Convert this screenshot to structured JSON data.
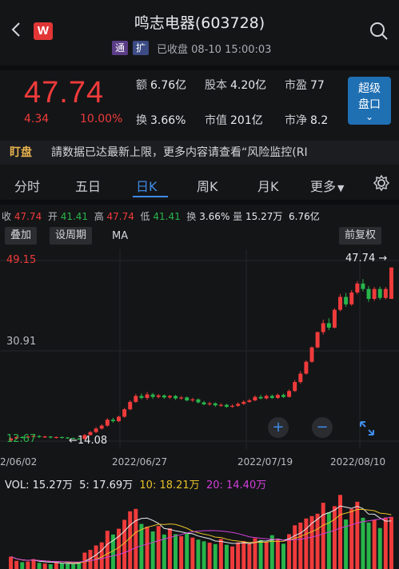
{
  "header": {
    "title": "鸣志电器(603728)",
    "logo_letter": "W",
    "tag_tong": "通",
    "tag_kuo": "扩",
    "status": "已收盘 08-10 15:00:03"
  },
  "quote": {
    "price": "47.74",
    "change": "4.34",
    "change_pct": "10.00%",
    "e_label": "额",
    "e_value": "6.76亿",
    "gb_label": "股本",
    "gb_value": "4.20亿",
    "sy_label": "市盈",
    "sy_value": "77",
    "h_label": "换",
    "h_value": "3.66%",
    "sz_label": "市值",
    "sz_value": "201亿",
    "sj_label": "市净",
    "sj_value": "8.2",
    "super_btn_line1": "超级",
    "super_btn_line2": "盘口",
    "super_btn_arrow": "⌄"
  },
  "ticker": {
    "tag": "盯盘",
    "text": "請数据已达最新上限，更多内容请查看“风险监控(RI"
  },
  "tabs": [
    "分时",
    "五日",
    "日K",
    "周K",
    "月K",
    "更多"
  ],
  "active_tab": "日K",
  "ohlc": {
    "close_label": "收",
    "close": "47.74",
    "open_label": "开",
    "open": "41.41",
    "high_label": "高",
    "high": "47.74",
    "low_label": "低",
    "low": "41.41",
    "turn_label": "换",
    "turn": "3.66%",
    "vol_label": "量",
    "vol": "15.27万",
    "amount": "6.76亿"
  },
  "tools": {
    "overlay": "叠加",
    "period": "设周期",
    "ma": "MA",
    "adjust": "前复权"
  },
  "kchart": {
    "y_top": "49.15",
    "y_mid": "30.91",
    "y_low": "12.67",
    "high_mark": "47.74",
    "low_mark": "14.08",
    "dates": [
      "2/06/02",
      "2022/06/27",
      "2022/07/19",
      "2022/08/10"
    ],
    "plus": "+",
    "minus": "−"
  },
  "vol": {
    "vol_label": "VOL: 15.27万",
    "ma5": "5: 17.69万",
    "ma10": "10: 18.21万",
    "ma20": "20: 14.40万",
    "ma10_color": "#e6c229",
    "ma20_color": "#d040d8"
  },
  "chart_data": {
    "type": "candlestick",
    "ylim": [
      12.67,
      49.15
    ],
    "x_ticks": [
      "2/06/02",
      "2022/06/27",
      "2022/07/19",
      "2022/08/10"
    ],
    "candles": [
      {
        "o": 12.8,
        "c": 13.2,
        "h": 13.4,
        "l": 12.6
      },
      {
        "o": 13.2,
        "c": 13.5,
        "h": 13.7,
        "l": 13.0
      },
      {
        "o": 13.5,
        "c": 13.4,
        "h": 13.7,
        "l": 13.2
      },
      {
        "o": 13.4,
        "c": 13.6,
        "h": 13.8,
        "l": 13.2
      },
      {
        "o": 13.6,
        "c": 13.7,
        "h": 13.9,
        "l": 13.4
      },
      {
        "o": 13.7,
        "c": 13.5,
        "h": 13.9,
        "l": 13.3
      },
      {
        "o": 13.5,
        "c": 13.6,
        "h": 13.8,
        "l": 13.3
      },
      {
        "o": 13.6,
        "c": 13.4,
        "h": 13.7,
        "l": 13.2
      },
      {
        "o": 13.4,
        "c": 13.5,
        "h": 13.6,
        "l": 13.2
      },
      {
        "o": 13.5,
        "c": 13.4,
        "h": 13.6,
        "l": 13.2
      },
      {
        "o": 13.4,
        "c": 13.3,
        "h": 13.5,
        "l": 13.1
      },
      {
        "o": 13.3,
        "c": 13.2,
        "h": 13.4,
        "l": 13.1
      },
      {
        "o": 13.2,
        "c": 13.1,
        "h": 13.3,
        "l": 12.9
      },
      {
        "o": 13.1,
        "c": 13.9,
        "h": 14.1,
        "l": 13.0
      },
      {
        "o": 13.9,
        "c": 14.5,
        "h": 14.7,
        "l": 13.8
      },
      {
        "o": 14.5,
        "c": 15.2,
        "h": 15.5,
        "l": 14.3
      },
      {
        "o": 15.2,
        "c": 15.8,
        "h": 16.1,
        "l": 15.0
      },
      {
        "o": 15.8,
        "c": 17.0,
        "h": 17.3,
        "l": 15.6
      },
      {
        "o": 17.0,
        "c": 16.7,
        "h": 17.4,
        "l": 16.4
      },
      {
        "o": 16.7,
        "c": 17.6,
        "h": 17.8,
        "l": 16.5
      },
      {
        "o": 17.6,
        "c": 19.1,
        "h": 19.4,
        "l": 17.4
      },
      {
        "o": 19.1,
        "c": 20.6,
        "h": 20.9,
        "l": 18.9
      },
      {
        "o": 20.6,
        "c": 21.8,
        "h": 22.2,
        "l": 20.4
      },
      {
        "o": 21.8,
        "c": 21.4,
        "h": 22.3,
        "l": 21.1
      },
      {
        "o": 21.4,
        "c": 22.1,
        "h": 22.6,
        "l": 21.0
      },
      {
        "o": 22.1,
        "c": 21.6,
        "h": 22.4,
        "l": 21.2
      },
      {
        "o": 21.6,
        "c": 21.9,
        "h": 22.2,
        "l": 21.3
      },
      {
        "o": 21.9,
        "c": 21.5,
        "h": 22.1,
        "l": 21.2
      },
      {
        "o": 21.5,
        "c": 21.8,
        "h": 22.0,
        "l": 21.2
      },
      {
        "o": 21.8,
        "c": 21.3,
        "h": 22.0,
        "l": 21.0
      },
      {
        "o": 21.3,
        "c": 21.5,
        "h": 21.8,
        "l": 21.0
      },
      {
        "o": 21.5,
        "c": 20.9,
        "h": 21.7,
        "l": 20.7
      },
      {
        "o": 20.9,
        "c": 21.1,
        "h": 21.4,
        "l": 20.6
      },
      {
        "o": 21.1,
        "c": 20.5,
        "h": 21.3,
        "l": 20.3
      },
      {
        "o": 20.5,
        "c": 20.1,
        "h": 20.8,
        "l": 19.9
      },
      {
        "o": 20.1,
        "c": 20.3,
        "h": 20.6,
        "l": 19.8
      },
      {
        "o": 20.3,
        "c": 19.9,
        "h": 20.5,
        "l": 19.6
      },
      {
        "o": 19.9,
        "c": 20.0,
        "h": 20.3,
        "l": 19.6
      },
      {
        "o": 20.0,
        "c": 19.6,
        "h": 20.2,
        "l": 19.4
      },
      {
        "o": 19.6,
        "c": 19.8,
        "h": 20.1,
        "l": 19.4
      },
      {
        "o": 19.8,
        "c": 20.2,
        "h": 20.5,
        "l": 19.6
      },
      {
        "o": 20.2,
        "c": 20.6,
        "h": 20.9,
        "l": 20.0
      },
      {
        "o": 20.6,
        "c": 20.9,
        "h": 21.2,
        "l": 20.4
      },
      {
        "o": 20.9,
        "c": 21.6,
        "h": 21.9,
        "l": 20.7
      },
      {
        "o": 21.6,
        "c": 21.3,
        "h": 22.0,
        "l": 21.1
      },
      {
        "o": 21.3,
        "c": 21.8,
        "h": 22.1,
        "l": 21.1
      },
      {
        "o": 21.8,
        "c": 21.4,
        "h": 22.1,
        "l": 21.2
      },
      {
        "o": 21.4,
        "c": 22.0,
        "h": 22.3,
        "l": 21.2
      },
      {
        "o": 22.0,
        "c": 21.6,
        "h": 22.3,
        "l": 21.4
      },
      {
        "o": 21.6,
        "c": 22.8,
        "h": 23.1,
        "l": 21.5
      },
      {
        "o": 22.8,
        "c": 24.6,
        "h": 25.0,
        "l": 22.6
      },
      {
        "o": 24.6,
        "c": 26.3,
        "h": 26.8,
        "l": 24.3
      },
      {
        "o": 26.3,
        "c": 28.7,
        "h": 29.0,
        "l": 26.1
      },
      {
        "o": 28.7,
        "c": 31.6,
        "h": 31.8,
        "l": 28.5
      },
      {
        "o": 31.6,
        "c": 34.7,
        "h": 34.8,
        "l": 31.4
      },
      {
        "o": 34.7,
        "c": 36.5,
        "h": 37.2,
        "l": 34.2
      },
      {
        "o": 36.5,
        "c": 35.6,
        "h": 37.5,
        "l": 35.1
      },
      {
        "o": 35.6,
        "c": 39.2,
        "h": 39.5,
        "l": 35.4
      },
      {
        "o": 39.2,
        "c": 41.8,
        "h": 42.4,
        "l": 38.9
      },
      {
        "o": 41.8,
        "c": 40.3,
        "h": 42.6,
        "l": 39.8
      },
      {
        "o": 40.3,
        "c": 42.7,
        "h": 43.2,
        "l": 40.0
      },
      {
        "o": 42.7,
        "c": 44.5,
        "h": 45.0,
        "l": 42.3
      },
      {
        "o": 44.5,
        "c": 43.4,
        "h": 45.4,
        "l": 42.9
      },
      {
        "o": 43.4,
        "c": 41.4,
        "h": 44.0,
        "l": 40.8
      },
      {
        "o": 41.4,
        "c": 43.4,
        "h": 43.8,
        "l": 41.0
      },
      {
        "o": 43.4,
        "c": 41.6,
        "h": 43.9,
        "l": 41.2
      },
      {
        "o": 41.6,
        "c": 43.4,
        "h": 43.8,
        "l": 41.3
      },
      {
        "o": 41.4,
        "c": 47.74,
        "h": 47.74,
        "l": 41.41
      }
    ],
    "volume": [
      3.6,
      2.4,
      2.0,
      2.2,
      2.9,
      1.8,
      1.6,
      1.4,
      2.0,
      1.7,
      1.5,
      1.4,
      2.0,
      4.8,
      5.6,
      6.9,
      7.8,
      11.2,
      10.1,
      11.8,
      14.4,
      16.9,
      17.6,
      13.2,
      12.4,
      11.0,
      12.6,
      10.1,
      11.9,
      10.2,
      9.6,
      10.7,
      9.2,
      8.6,
      8.1,
      7.7,
      7.3,
      8.8,
      7.1,
      6.6,
      7.8,
      8.2,
      7.4,
      9.0,
      8.5,
      7.9,
      9.9,
      8.6,
      7.4,
      10.2,
      12.8,
      13.6,
      14.8,
      15.5,
      16.2,
      19.4,
      16.6,
      18.4,
      21.7,
      14.5,
      17.6,
      19.7,
      15.0,
      13.6,
      14.4,
      12.0,
      15.1,
      15.27
    ],
    "vol_max": 22
  }
}
